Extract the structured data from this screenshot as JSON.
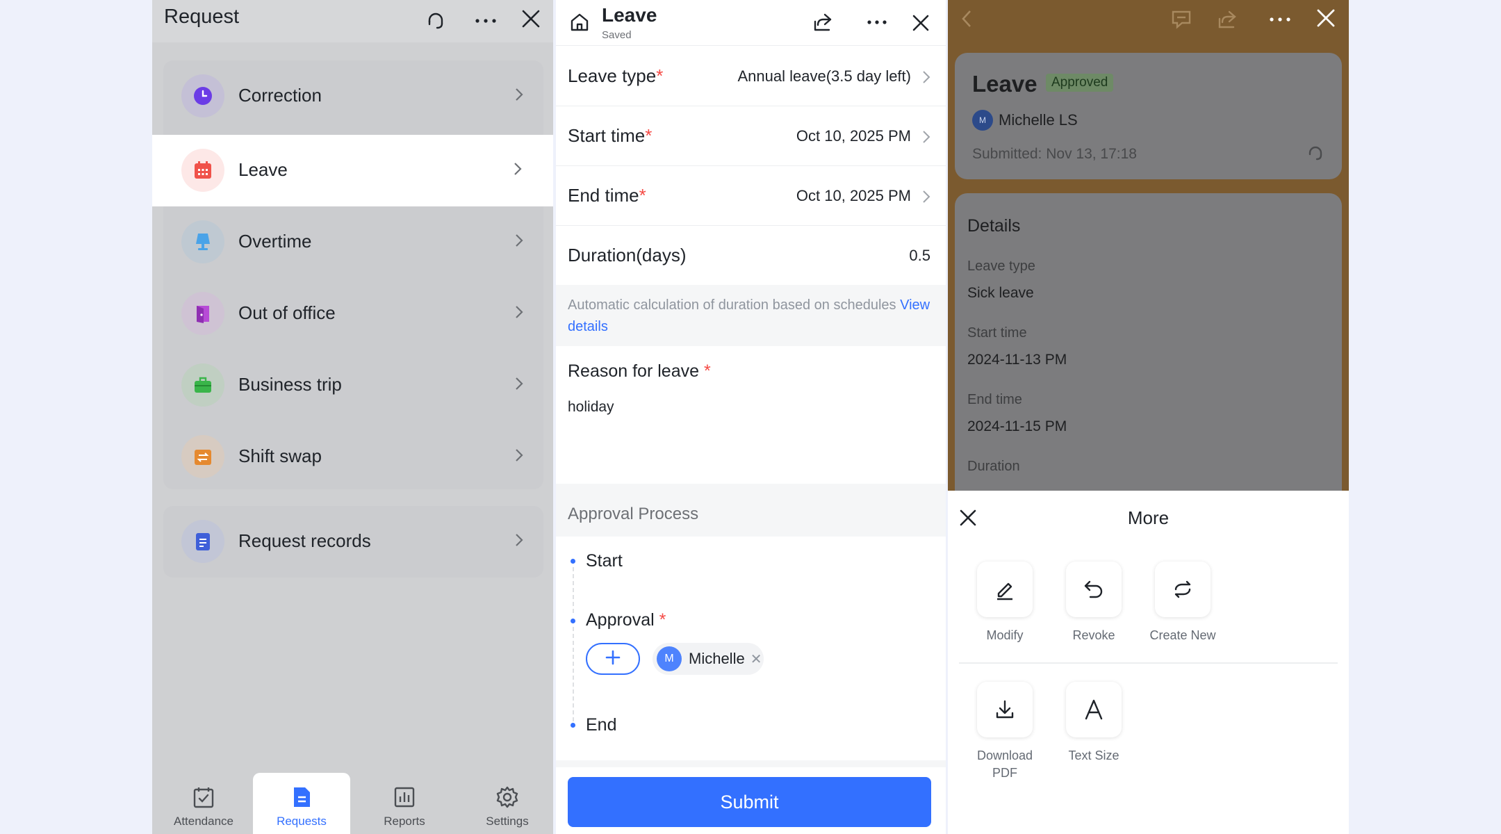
{
  "request_panel": {
    "title": "Request",
    "items": [
      {
        "label": "Correction",
        "icon": "clock-icon",
        "color": "#6b3ce6",
        "bg": "#c4c0d6"
      },
      {
        "label": "Leave",
        "icon": "calendar-icon",
        "color": "#f0524a",
        "bg": "#fde8e7"
      },
      {
        "label": "Overtime",
        "icon": "lamp-icon",
        "color": "#4aa3e8",
        "bg": "#bfc9d2"
      },
      {
        "label": "Out of office",
        "icon": "door-icon",
        "color": "#b74bd6",
        "bg": "#cfc3d4"
      },
      {
        "label": "Business trip",
        "icon": "briefcase-icon",
        "color": "#3ab54a",
        "bg": "#c0cfc2"
      },
      {
        "label": "Shift swap",
        "icon": "swap-icon",
        "color": "#e5892f",
        "bg": "#d7cbc1"
      }
    ],
    "records": {
      "label": "Request records",
      "icon": "document-icon",
      "color": "#3f5fd9",
      "bg": "#c2c6d6"
    },
    "tabs": [
      {
        "label": "Attendance",
        "icon": "calendar-check-icon"
      },
      {
        "label": "Requests",
        "icon": "document-icon"
      },
      {
        "label": "Reports",
        "icon": "bar-chart-icon"
      },
      {
        "label": "Settings",
        "icon": "gear-icon"
      }
    ],
    "active_tab": "Requests"
  },
  "leave_form": {
    "title": "Leave",
    "status": "Saved",
    "fields": [
      {
        "label": "Leave type",
        "required": "*",
        "value": "Annual leave(3.5 day left)"
      },
      {
        "label": "Start time",
        "required": "*",
        "value": "Oct 10, 2025 PM"
      },
      {
        "label": "End time",
        "required": "*",
        "value": "Oct 10, 2025 PM"
      },
      {
        "label": "Duration(days)",
        "value": "0.5"
      }
    ],
    "note_text": "Automatic calculation of duration based on schedules",
    "note_link": "View details",
    "reason_label": "Reason for leave",
    "reason_required": "*",
    "reason_value": "holiday",
    "approval_section": "Approval Process",
    "flow": {
      "start": "Start",
      "approval": "Approval",
      "approval_required": "*",
      "approver_initial": "M",
      "approver_name": "Michelle",
      "end": "End"
    },
    "submit_label": "Submit",
    "accent": "#3370ff"
  },
  "leave_detail": {
    "title": "Leave",
    "badge": "Approved",
    "user_initial": "M",
    "user_name": "Michelle LS",
    "submitted": "Submitted: Nov 13, 17:18",
    "details_heading": "Details",
    "details": [
      {
        "key": "Leave type",
        "value": "Sick leave"
      },
      {
        "key": "Start time",
        "value": "2024-11-13 PM"
      },
      {
        "key": "End time",
        "value": "2024-11-15 PM"
      },
      {
        "key": "Duration",
        "value": ""
      }
    ],
    "sheet": {
      "title": "More",
      "actions_row1": [
        {
          "label": "Modify",
          "icon": "pencil-icon"
        },
        {
          "label": "Revoke",
          "icon": "undo-icon"
        },
        {
          "label": "Create New",
          "icon": "refresh-icon"
        }
      ],
      "actions_row2": [
        {
          "label": "Download PDF",
          "icon": "download-icon"
        },
        {
          "label": "Text Size",
          "icon": "text-size-icon"
        }
      ]
    }
  }
}
